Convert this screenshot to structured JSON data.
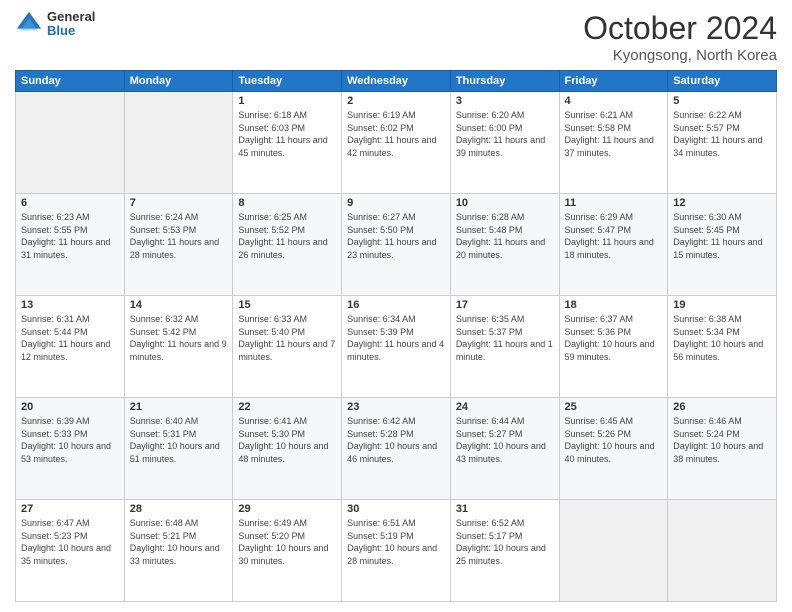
{
  "header": {
    "logo_general": "General",
    "logo_blue": "Blue",
    "month_title": "October 2024",
    "location": "Kyongsong, North Korea"
  },
  "weekdays": [
    "Sunday",
    "Monday",
    "Tuesday",
    "Wednesday",
    "Thursday",
    "Friday",
    "Saturday"
  ],
  "weeks": [
    [
      {
        "day": "",
        "sunrise": "",
        "sunset": "",
        "daylight": ""
      },
      {
        "day": "",
        "sunrise": "",
        "sunset": "",
        "daylight": ""
      },
      {
        "day": "1",
        "sunrise": "Sunrise: 6:18 AM",
        "sunset": "Sunset: 6:03 PM",
        "daylight": "Daylight: 11 hours and 45 minutes."
      },
      {
        "day": "2",
        "sunrise": "Sunrise: 6:19 AM",
        "sunset": "Sunset: 6:02 PM",
        "daylight": "Daylight: 11 hours and 42 minutes."
      },
      {
        "day": "3",
        "sunrise": "Sunrise: 6:20 AM",
        "sunset": "Sunset: 6:00 PM",
        "daylight": "Daylight: 11 hours and 39 minutes."
      },
      {
        "day": "4",
        "sunrise": "Sunrise: 6:21 AM",
        "sunset": "Sunset: 5:58 PM",
        "daylight": "Daylight: 11 hours and 37 minutes."
      },
      {
        "day": "5",
        "sunrise": "Sunrise: 6:22 AM",
        "sunset": "Sunset: 5:57 PM",
        "daylight": "Daylight: 11 hours and 34 minutes."
      }
    ],
    [
      {
        "day": "6",
        "sunrise": "Sunrise: 6:23 AM",
        "sunset": "Sunset: 5:55 PM",
        "daylight": "Daylight: 11 hours and 31 minutes."
      },
      {
        "day": "7",
        "sunrise": "Sunrise: 6:24 AM",
        "sunset": "Sunset: 5:53 PM",
        "daylight": "Daylight: 11 hours and 28 minutes."
      },
      {
        "day": "8",
        "sunrise": "Sunrise: 6:25 AM",
        "sunset": "Sunset: 5:52 PM",
        "daylight": "Daylight: 11 hours and 26 minutes."
      },
      {
        "day": "9",
        "sunrise": "Sunrise: 6:27 AM",
        "sunset": "Sunset: 5:50 PM",
        "daylight": "Daylight: 11 hours and 23 minutes."
      },
      {
        "day": "10",
        "sunrise": "Sunrise: 6:28 AM",
        "sunset": "Sunset: 5:48 PM",
        "daylight": "Daylight: 11 hours and 20 minutes."
      },
      {
        "day": "11",
        "sunrise": "Sunrise: 6:29 AM",
        "sunset": "Sunset: 5:47 PM",
        "daylight": "Daylight: 11 hours and 18 minutes."
      },
      {
        "day": "12",
        "sunrise": "Sunrise: 6:30 AM",
        "sunset": "Sunset: 5:45 PM",
        "daylight": "Daylight: 11 hours and 15 minutes."
      }
    ],
    [
      {
        "day": "13",
        "sunrise": "Sunrise: 6:31 AM",
        "sunset": "Sunset: 5:44 PM",
        "daylight": "Daylight: 11 hours and 12 minutes."
      },
      {
        "day": "14",
        "sunrise": "Sunrise: 6:32 AM",
        "sunset": "Sunset: 5:42 PM",
        "daylight": "Daylight: 11 hours and 9 minutes."
      },
      {
        "day": "15",
        "sunrise": "Sunrise: 6:33 AM",
        "sunset": "Sunset: 5:40 PM",
        "daylight": "Daylight: 11 hours and 7 minutes."
      },
      {
        "day": "16",
        "sunrise": "Sunrise: 6:34 AM",
        "sunset": "Sunset: 5:39 PM",
        "daylight": "Daylight: 11 hours and 4 minutes."
      },
      {
        "day": "17",
        "sunrise": "Sunrise: 6:35 AM",
        "sunset": "Sunset: 5:37 PM",
        "daylight": "Daylight: 11 hours and 1 minute."
      },
      {
        "day": "18",
        "sunrise": "Sunrise: 6:37 AM",
        "sunset": "Sunset: 5:36 PM",
        "daylight": "Daylight: 10 hours and 59 minutes."
      },
      {
        "day": "19",
        "sunrise": "Sunrise: 6:38 AM",
        "sunset": "Sunset: 5:34 PM",
        "daylight": "Daylight: 10 hours and 56 minutes."
      }
    ],
    [
      {
        "day": "20",
        "sunrise": "Sunrise: 6:39 AM",
        "sunset": "Sunset: 5:33 PM",
        "daylight": "Daylight: 10 hours and 53 minutes."
      },
      {
        "day": "21",
        "sunrise": "Sunrise: 6:40 AM",
        "sunset": "Sunset: 5:31 PM",
        "daylight": "Daylight: 10 hours and 51 minutes."
      },
      {
        "day": "22",
        "sunrise": "Sunrise: 6:41 AM",
        "sunset": "Sunset: 5:30 PM",
        "daylight": "Daylight: 10 hours and 48 minutes."
      },
      {
        "day": "23",
        "sunrise": "Sunrise: 6:42 AM",
        "sunset": "Sunset: 5:28 PM",
        "daylight": "Daylight: 10 hours and 46 minutes."
      },
      {
        "day": "24",
        "sunrise": "Sunrise: 6:44 AM",
        "sunset": "Sunset: 5:27 PM",
        "daylight": "Daylight: 10 hours and 43 minutes."
      },
      {
        "day": "25",
        "sunrise": "Sunrise: 6:45 AM",
        "sunset": "Sunset: 5:26 PM",
        "daylight": "Daylight: 10 hours and 40 minutes."
      },
      {
        "day": "26",
        "sunrise": "Sunrise: 6:46 AM",
        "sunset": "Sunset: 5:24 PM",
        "daylight": "Daylight: 10 hours and 38 minutes."
      }
    ],
    [
      {
        "day": "27",
        "sunrise": "Sunrise: 6:47 AM",
        "sunset": "Sunset: 5:23 PM",
        "daylight": "Daylight: 10 hours and 35 minutes."
      },
      {
        "day": "28",
        "sunrise": "Sunrise: 6:48 AM",
        "sunset": "Sunset: 5:21 PM",
        "daylight": "Daylight: 10 hours and 33 minutes."
      },
      {
        "day": "29",
        "sunrise": "Sunrise: 6:49 AM",
        "sunset": "Sunset: 5:20 PM",
        "daylight": "Daylight: 10 hours and 30 minutes."
      },
      {
        "day": "30",
        "sunrise": "Sunrise: 6:51 AM",
        "sunset": "Sunset: 5:19 PM",
        "daylight": "Daylight: 10 hours and 28 minutes."
      },
      {
        "day": "31",
        "sunrise": "Sunrise: 6:52 AM",
        "sunset": "Sunset: 5:17 PM",
        "daylight": "Daylight: 10 hours and 25 minutes."
      },
      {
        "day": "",
        "sunrise": "",
        "sunset": "",
        "daylight": ""
      },
      {
        "day": "",
        "sunrise": "",
        "sunset": "",
        "daylight": ""
      }
    ]
  ]
}
